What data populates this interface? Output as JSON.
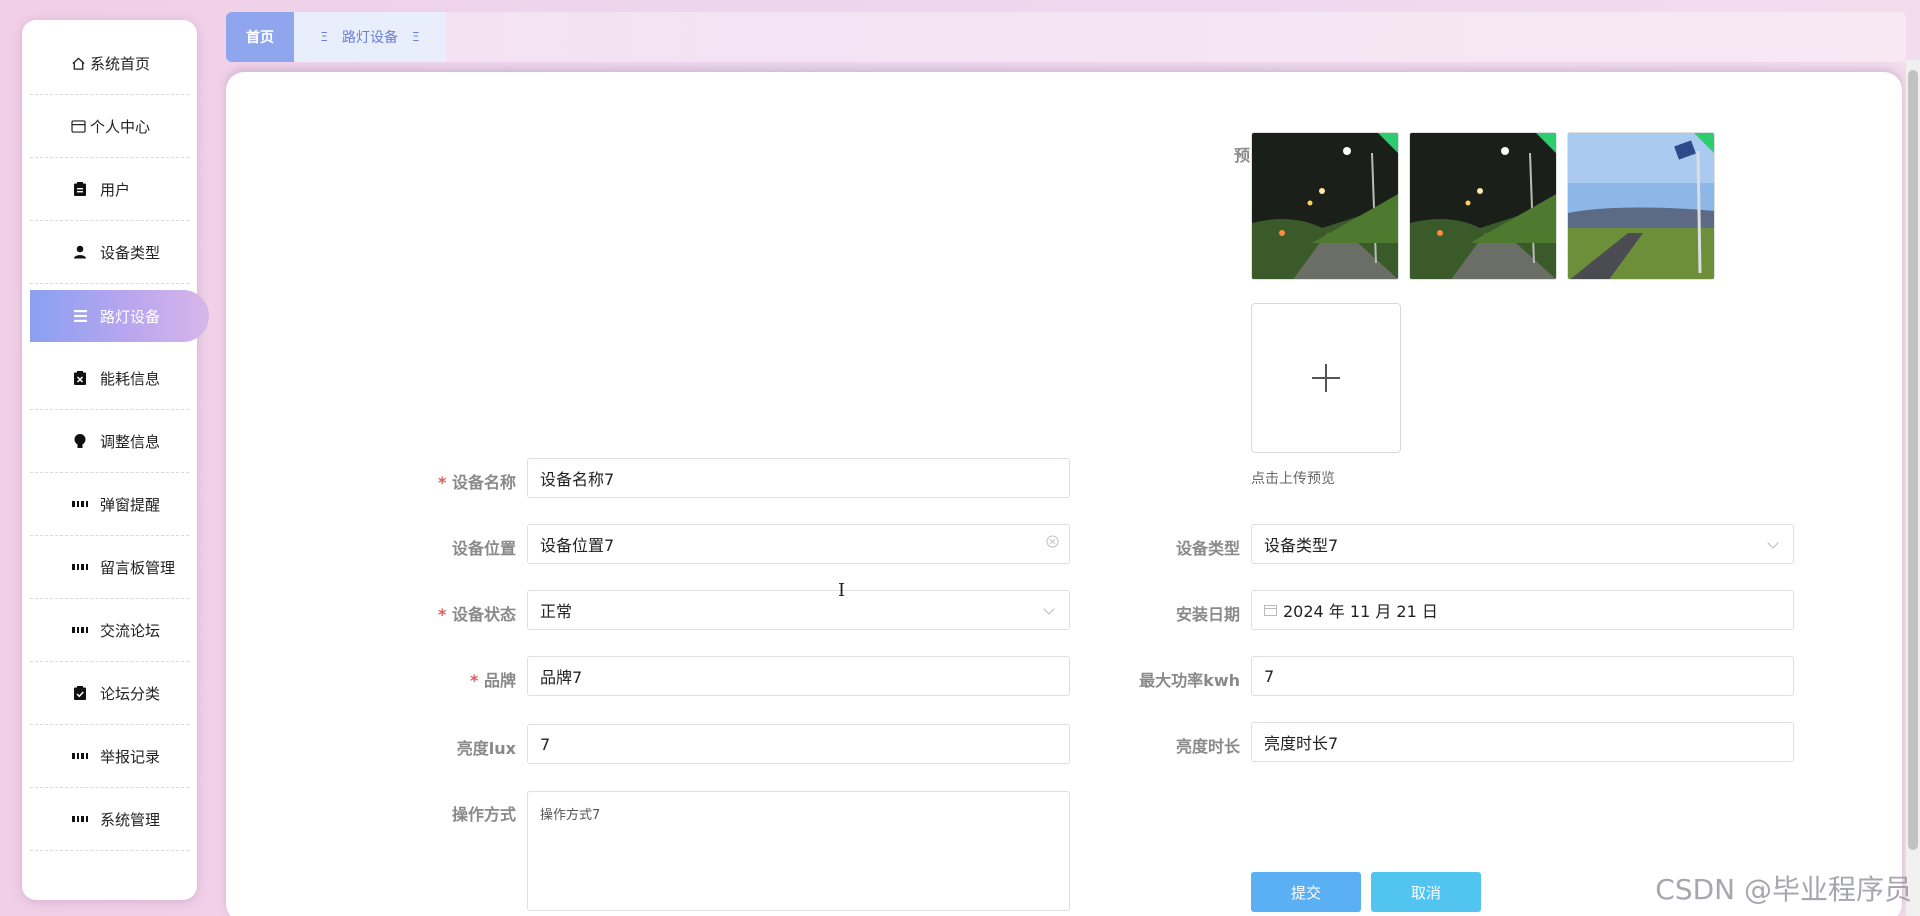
{
  "sidebar": {
    "items": [
      {
        "label": "系统首页",
        "icon": "home-icon"
      },
      {
        "label": "个人中心",
        "icon": "card-icon"
      },
      {
        "label": "用户",
        "icon": "clipboard-icon"
      },
      {
        "label": "设备类型",
        "icon": "user-icon"
      },
      {
        "label": "路灯设备",
        "icon": "list-icon",
        "active": true
      },
      {
        "label": "能耗信息",
        "icon": "clipboard-x-icon"
      },
      {
        "label": "调整信息",
        "icon": "bulb-icon"
      },
      {
        "label": "弹窗提醒",
        "icon": "grid-icon"
      },
      {
        "label": "留言板管理",
        "icon": "grid-icon"
      },
      {
        "label": "交流论坛",
        "icon": "grid-icon"
      },
      {
        "label": "论坛分类",
        "icon": "clipboard-check-icon"
      },
      {
        "label": "举报记录",
        "icon": "grid-icon"
      },
      {
        "label": "系统管理",
        "icon": "grid-icon"
      }
    ]
  },
  "tabs": {
    "home": "首页",
    "device": "路灯设备",
    "device_symbol": "Ξ"
  },
  "form": {
    "preview_label": "预览",
    "upload_hint": "点击上传预览",
    "device_name": {
      "label": "设备名称",
      "value": "设备名称7"
    },
    "device_location": {
      "label": "设备位置",
      "value": "设备位置7"
    },
    "device_type": {
      "label": "设备类型",
      "value": "设备类型7"
    },
    "device_status": {
      "label": "设备状态",
      "value": "正常"
    },
    "install_date": {
      "label": "安装日期",
      "value": "2024 年 11 月 21 日"
    },
    "brand": {
      "label": "品牌",
      "value": "品牌7"
    },
    "max_power": {
      "label": "最大功率kwh",
      "value": "7"
    },
    "brightness": {
      "label": "亮度lux",
      "value": "7"
    },
    "brightness_duration": {
      "label": "亮度时长",
      "value": "亮度时长7"
    },
    "operation_mode": {
      "label": "操作方式",
      "value": "操作方式7"
    },
    "submit_label": "提交",
    "cancel_label": "取消"
  },
  "watermark": "CSDN @毕业程序员",
  "colors": {
    "accent": "#8fa6ee",
    "submit": "#5ab0f2",
    "cancel": "#52c4f0",
    "required": "#e05a5a"
  }
}
